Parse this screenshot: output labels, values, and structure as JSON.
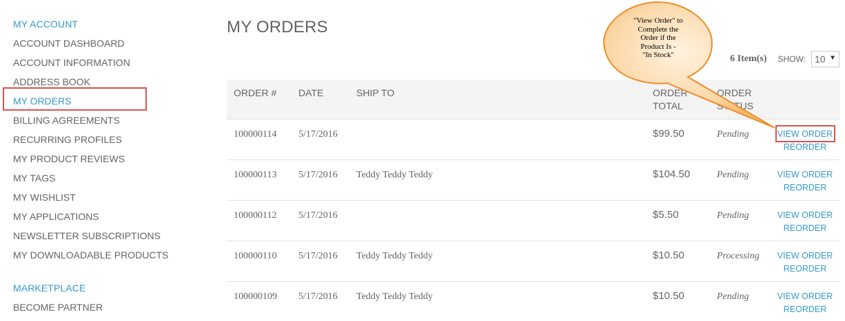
{
  "sidebar": {
    "account_heading": "MY ACCOUNT",
    "items": [
      {
        "label": "ACCOUNT DASHBOARD"
      },
      {
        "label": "ACCOUNT INFORMATION"
      },
      {
        "label": "ADDRESS BOOK"
      },
      {
        "label": "MY ORDERS",
        "active": true
      },
      {
        "label": "BILLING AGREEMENTS"
      },
      {
        "label": "RECURRING PROFILES"
      },
      {
        "label": "MY PRODUCT REVIEWS"
      },
      {
        "label": "MY TAGS"
      },
      {
        "label": "MY WISHLIST"
      },
      {
        "label": "MY APPLICATIONS"
      },
      {
        "label": "NEWSLETTER SUBSCRIPTIONS"
      },
      {
        "label": "MY DOWNLOADABLE PRODUCTS"
      }
    ],
    "marketplace_heading": "MARKETPLACE",
    "marketplace_items": [
      {
        "label": "BECOME PARTNER"
      }
    ]
  },
  "main": {
    "title": "MY ORDERS",
    "item_count": "6 Item(s)",
    "show_label": "SHOW:",
    "show_value": "10",
    "columns": {
      "order": "ORDER #",
      "date": "DATE",
      "ship_to": "SHIP TO",
      "total_line1": "ORDER",
      "total_line2": "TOTAL",
      "status_line1": "ORDER",
      "status_line2": "STATUS"
    },
    "rows": [
      {
        "order": "100000114",
        "date": "5/17/2016",
        "ship_to": "",
        "total": "$99.50",
        "status": "Pending",
        "view": "VIEW ORDER",
        "reorder": "REORDER"
      },
      {
        "order": "100000113",
        "date": "5/17/2016",
        "ship_to": "Teddy Teddy Teddy",
        "total": "$104.50",
        "status": "Pending",
        "view": "VIEW ORDER",
        "reorder": "REORDER"
      },
      {
        "order": "100000112",
        "date": "5/17/2016",
        "ship_to": "",
        "total": "$5.50",
        "status": "Pending",
        "view": "VIEW ORDER",
        "reorder": "REORDER"
      },
      {
        "order": "100000110",
        "date": "5/17/2016",
        "ship_to": "Teddy Teddy Teddy",
        "total": "$10.50",
        "status": "Processing",
        "view": "VIEW ORDER",
        "reorder": "REORDER"
      },
      {
        "order": "100000109",
        "date": "5/17/2016",
        "ship_to": "Teddy Teddy Teddy",
        "total": "$10.50",
        "status": "Pending",
        "view": "VIEW ORDER",
        "reorder": "REORDER"
      }
    ]
  },
  "callout": {
    "lines": [
      "\"View Order\" to",
      "Complete the",
      "Order if the",
      "Product Is -",
      "\"In Stock\""
    ]
  },
  "colors": {
    "accent": "#3399cc",
    "highlight": "#d9534f",
    "callout_fill": "#fbd7a6",
    "callout_stroke": "#ed8d2a"
  }
}
